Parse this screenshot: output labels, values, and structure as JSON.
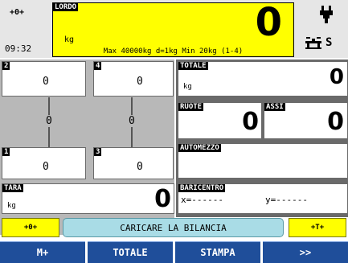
{
  "header": {
    "zero_symbol": "+0+",
    "time": "09:32",
    "gross_label": "LORDO",
    "gross_value": "0",
    "gross_unit": "kg",
    "range_info": "Max 40000kg d=1kg Min 20kg (1-4)",
    "status_letter": "S"
  },
  "platforms": [
    {
      "number": "2",
      "value": "0"
    },
    {
      "number": "4",
      "value": "0"
    },
    {
      "number": "1",
      "value": "0"
    },
    {
      "number": "3",
      "value": "0"
    }
  ],
  "axle_middle_values": [
    "0",
    "0"
  ],
  "totale": {
    "label": "TOTALE",
    "value": "0",
    "unit": "kg"
  },
  "ruote": {
    "label": "RUOTE",
    "value": "0"
  },
  "assi": {
    "label": "ASSI",
    "value": "0"
  },
  "automezzo": {
    "label": "AUTOMEZZO",
    "value": ""
  },
  "tara": {
    "label": "TARA",
    "value": "0",
    "unit": "kg"
  },
  "baricentro": {
    "label": "BARICENTRO",
    "x_text": "x=------",
    "y_text": "y=------"
  },
  "message_row": {
    "left_symbol": "+0+",
    "message": "CARICARE LA BILANCIA",
    "right_symbol": "+T+"
  },
  "softkeys": [
    "M+",
    "TOTALE",
    "STAMPA",
    ">>"
  ],
  "colors": {
    "gross_bg": "#ffff00",
    "message_bg": "#a9dce6",
    "button_yellow": "#ffff00",
    "softkey_bg": "#1f4e9a"
  },
  "icons": {
    "power": "plug-icon",
    "scale": "scale-icon"
  }
}
